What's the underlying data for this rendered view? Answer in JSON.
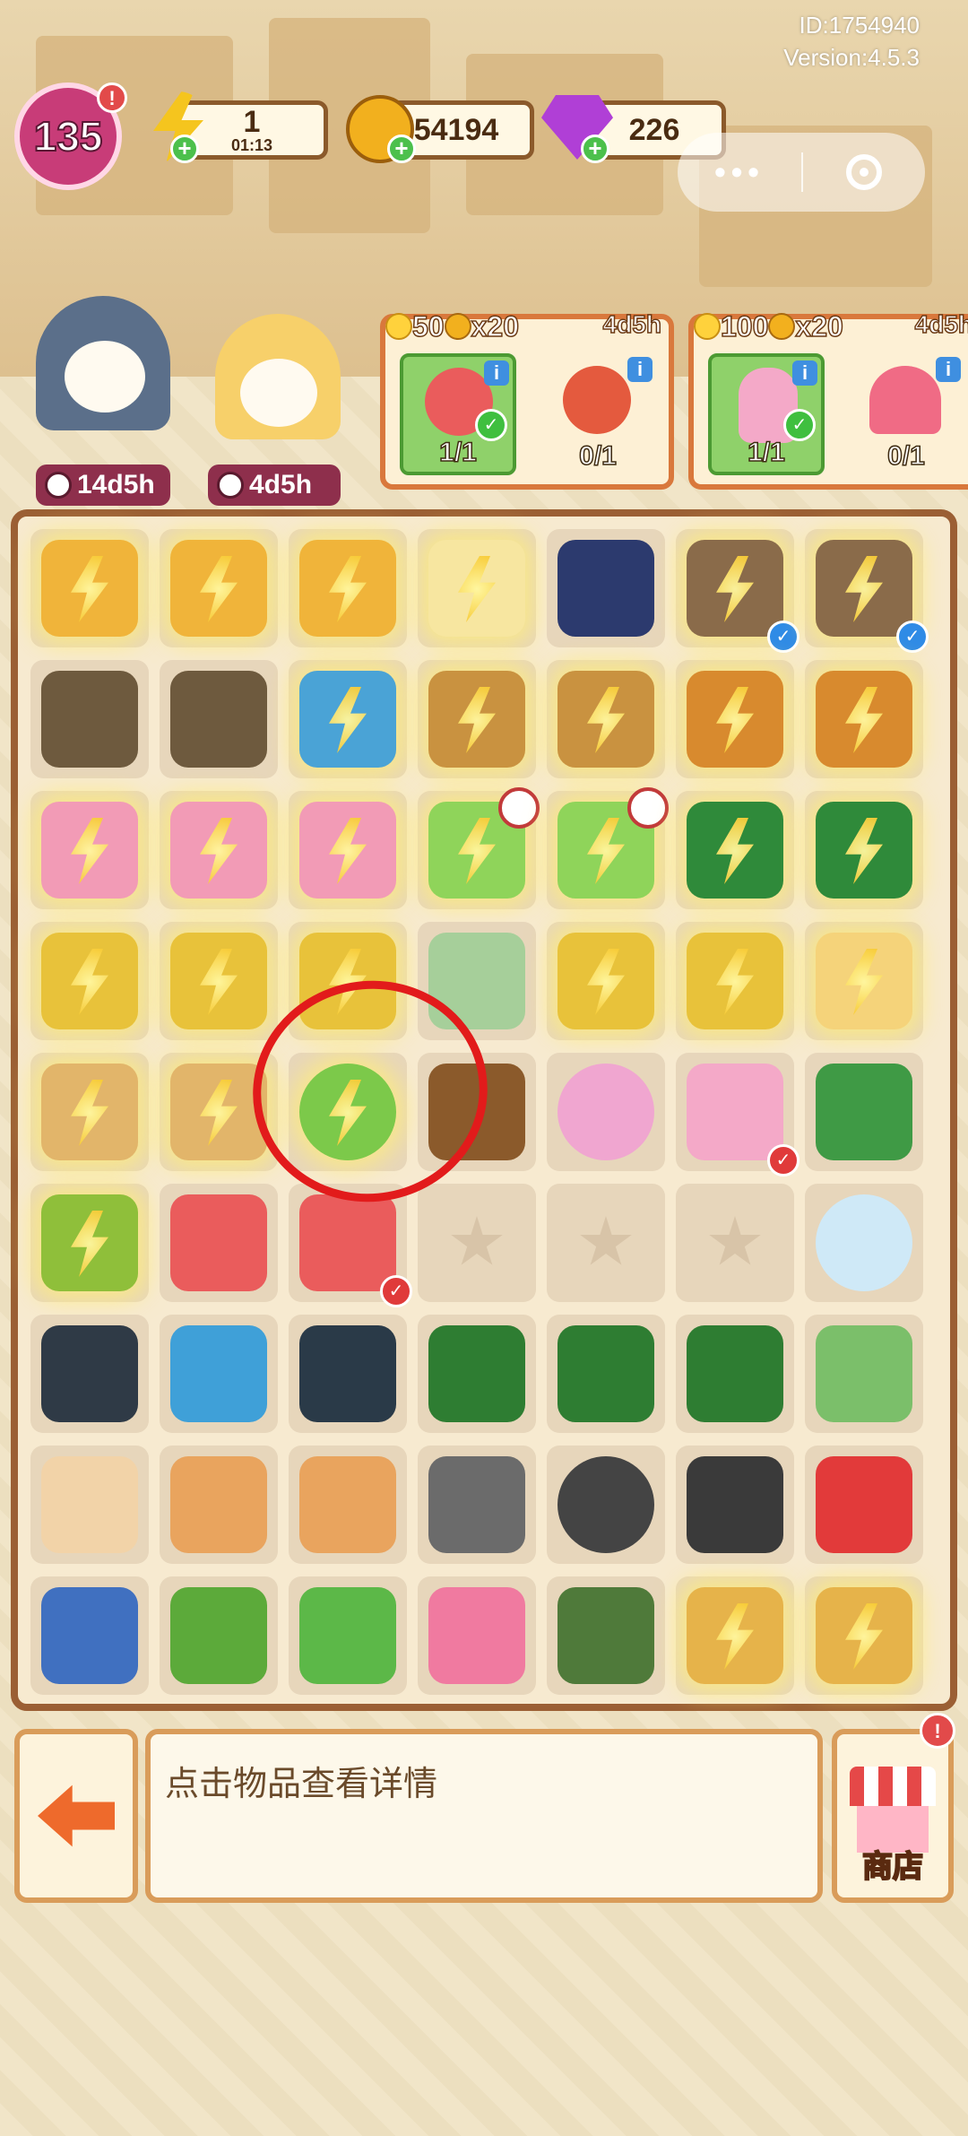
{
  "top_info": {
    "id": "ID:1754940",
    "version": "Version:4.5.3"
  },
  "hud": {
    "level": "135",
    "energy": {
      "value": "1",
      "timer": "01:13"
    },
    "coins": "54194",
    "gems": "226",
    "notif_mark": "!"
  },
  "capsule": {
    "more": "•••"
  },
  "characters": [
    {
      "timer": "14d5h"
    },
    {
      "timer": "4d5h"
    }
  ],
  "orders": [
    {
      "reward_flowers": "50",
      "reward_coins": "x20",
      "time": "4d5h",
      "slots": [
        {
          "count": "1/1",
          "done": true,
          "item": "apple-slice"
        },
        {
          "count": "0/1",
          "done": false,
          "item": "red-fruit"
        }
      ]
    },
    {
      "reward_flowers": "100",
      "reward_coins": "x20",
      "time": "4d5h",
      "slots": [
        {
          "count": "1/1",
          "done": true,
          "item": "flower-vase"
        },
        {
          "count": "0/1",
          "done": false,
          "item": "cupcake"
        }
      ]
    }
  ],
  "board": {
    "highlighted_item": "green-bush",
    "rows": [
      [
        "pineapple-crate",
        "pineapple-crate",
        "pineapple-crate",
        "lemon-drink",
        "headphones",
        "camera-bag",
        "camera-bag"
      ],
      [
        "locker",
        "locker",
        "ice-box",
        "basket",
        "basket",
        "fruit-basket",
        "fruit-basket"
      ],
      [
        "pink-suitcase",
        "pink-suitcase",
        "pink-suitcase",
        "laptop",
        "laptop",
        "green-case",
        "green-case"
      ],
      [
        "shopping-cart",
        "shopping-cart",
        "shopping-cart",
        "notebook",
        "shopping-cart",
        "shopping-cart",
        "toy-car"
      ],
      [
        "cardboard-box",
        "cardboard-box",
        "green-bush",
        "coffee-mug",
        "alarm-clock",
        "flower-vase",
        "hand-saw"
      ],
      [
        "seed-bag",
        "apple-slice",
        "apple-slice",
        "empty",
        "empty",
        "empty",
        "bubble"
      ],
      [
        "dumbbell-plates",
        "jump-rope",
        "ab-roller",
        "green-toolbox",
        "green-toolbox",
        "green-stand",
        "green-gloves"
      ],
      [
        "bandage",
        "sandwich",
        "sandwich",
        "cart-frame",
        "wheel",
        "wheels",
        "red-book"
      ],
      [
        "backpack",
        "toy-tank",
        "mirror",
        "watering-can",
        "work-gloves",
        "cat-bed",
        "cat-bed"
      ]
    ]
  },
  "details_text": "点击物品查看详情",
  "shop_label": "商店",
  "colors": {
    "board_border": "#9b5f34",
    "highlight_circle": "#e21b1b",
    "order_border": "#d9783c"
  }
}
